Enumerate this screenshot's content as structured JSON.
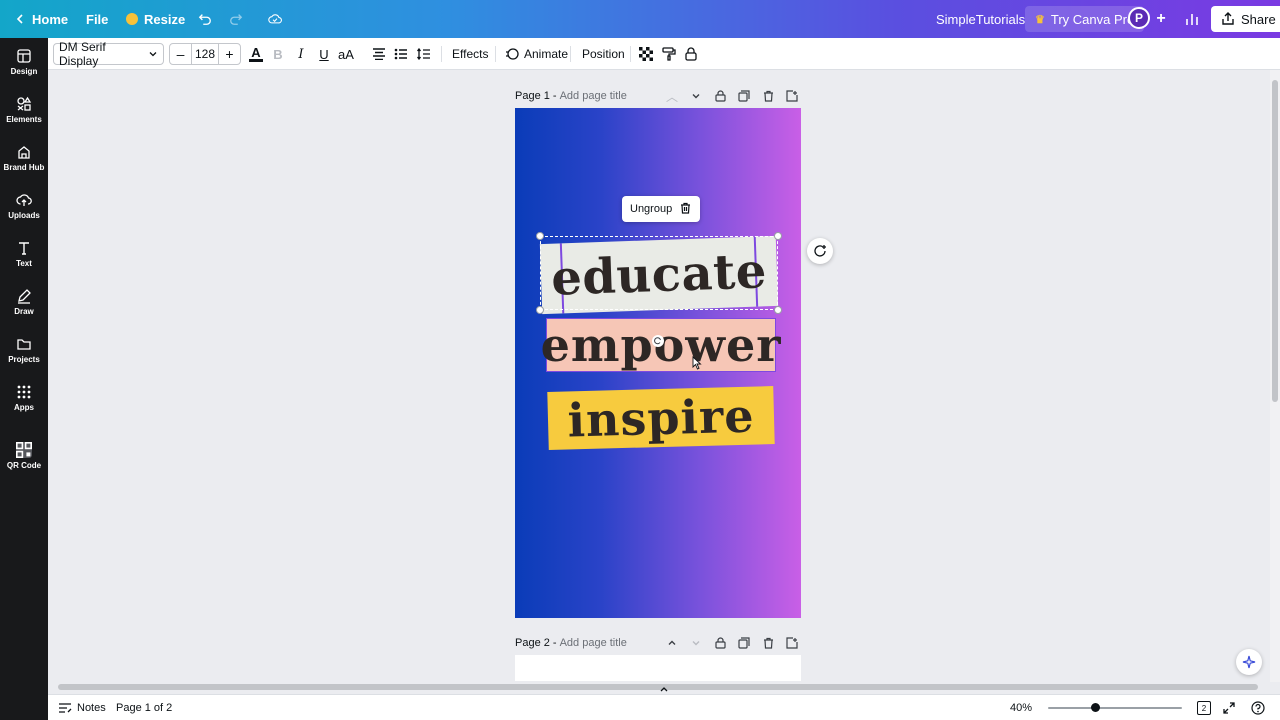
{
  "topbar": {
    "home_label": "Home",
    "file_label": "File",
    "resize_label": "Resize",
    "team_name": "SimpleTutorials",
    "try_pro_label": "Try Canva Pro",
    "avatar_initial": "P",
    "share_label": "Share"
  },
  "rail": {
    "items": [
      {
        "label": "Design"
      },
      {
        "label": "Elements"
      },
      {
        "label": "Brand Hub"
      },
      {
        "label": "Uploads"
      },
      {
        "label": "Text"
      },
      {
        "label": "Draw"
      },
      {
        "label": "Projects"
      },
      {
        "label": "Apps"
      },
      {
        "label": "QR Code"
      }
    ]
  },
  "toolbar": {
    "font_name": "DM Serif Display",
    "font_size": "128",
    "minus": "–",
    "plus": "+",
    "effects_label": "Effects",
    "animate_label": "Animate",
    "position_label": "Position"
  },
  "pages": [
    {
      "label": "Page 1 -",
      "title_placeholder": "Add page title"
    },
    {
      "label": "Page 2 -",
      "title_placeholder": "Add page title"
    }
  ],
  "design": {
    "words": [
      "educate",
      "empower",
      "inspire"
    ],
    "colors": {
      "educate_bg": "#e9ebe6",
      "empower_bg": "#f6c6b6",
      "inspire_bg": "#f7cb3e",
      "gradient_start": "#0a3cb8",
      "gradient_end": "#c95fe6"
    }
  },
  "popover": {
    "ungroup_label": "Ungroup"
  },
  "bottombar": {
    "notes_label": "Notes",
    "page_indicator": "Page 1 of 2",
    "zoom": "40%",
    "page_count": "2"
  }
}
